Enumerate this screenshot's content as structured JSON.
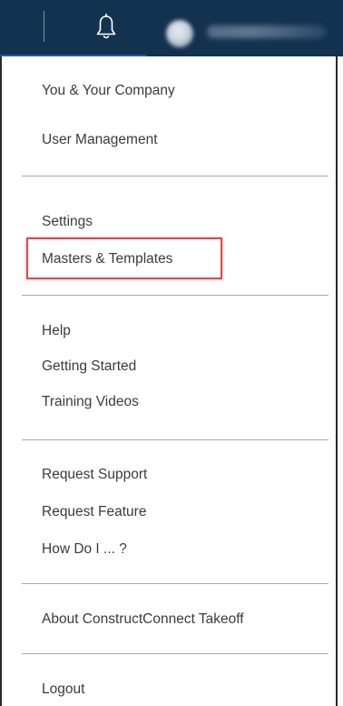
{
  "header": {
    "bell_icon": "bell-icon",
    "avatar_icon": "user-avatar-icon",
    "user_name": ""
  },
  "menu": {
    "items": [
      {
        "label": "You & Your Company"
      },
      {
        "label": "User Management"
      },
      {
        "label": "Settings"
      },
      {
        "label": "Masters & Templates"
      },
      {
        "label": "Help"
      },
      {
        "label": "Getting Started"
      },
      {
        "label": "Training Videos"
      },
      {
        "label": "Request Support"
      },
      {
        "label": "Request Feature"
      },
      {
        "label": "How Do I ... ?"
      },
      {
        "label": "About ConstructConnect Takeoff"
      },
      {
        "label": "Logout"
      }
    ],
    "highlighted_item": "Masters & Templates",
    "highlight_color": "#e0474c"
  },
  "colors": {
    "header_background": "#13324f",
    "menu_text": "#3b3b3b",
    "separator": "#a9a9a9"
  }
}
